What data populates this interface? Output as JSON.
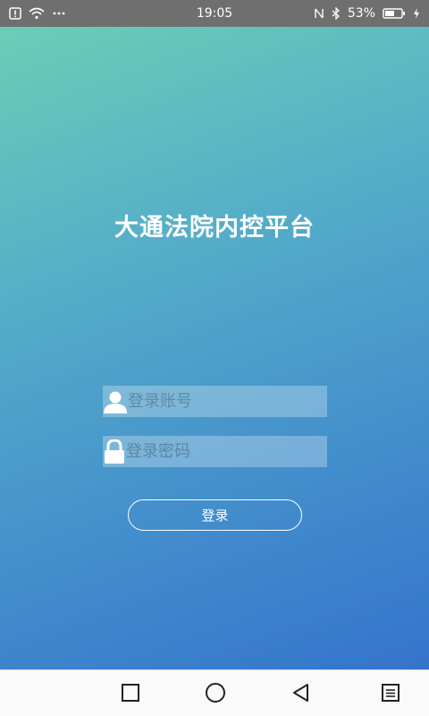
{
  "status_bar": {
    "time": "19:05",
    "battery_percent": "53%",
    "icons_left": [
      "alert-icon",
      "wifi-icon",
      "more-dots-icon"
    ],
    "icons_right": [
      "nfc-icon",
      "bluetooth-icon",
      "battery-icon",
      "charging-icon"
    ]
  },
  "app": {
    "title": "大通法院内控平台"
  },
  "login_form": {
    "account_placeholder": "登录账号",
    "password_placeholder": "登录密码",
    "account_icon": "user-icon",
    "password_icon": "lock-icon",
    "submit_label": "登录"
  },
  "nav_bar": {
    "buttons": [
      "recent-apps-icon",
      "home-icon",
      "back-icon",
      "menu-icon"
    ]
  },
  "colors": {
    "gradient_start": "#6ccdb6",
    "gradient_end": "#3474cc",
    "status_bar_bg": "#6f6f6f",
    "text": "#ffffff"
  }
}
